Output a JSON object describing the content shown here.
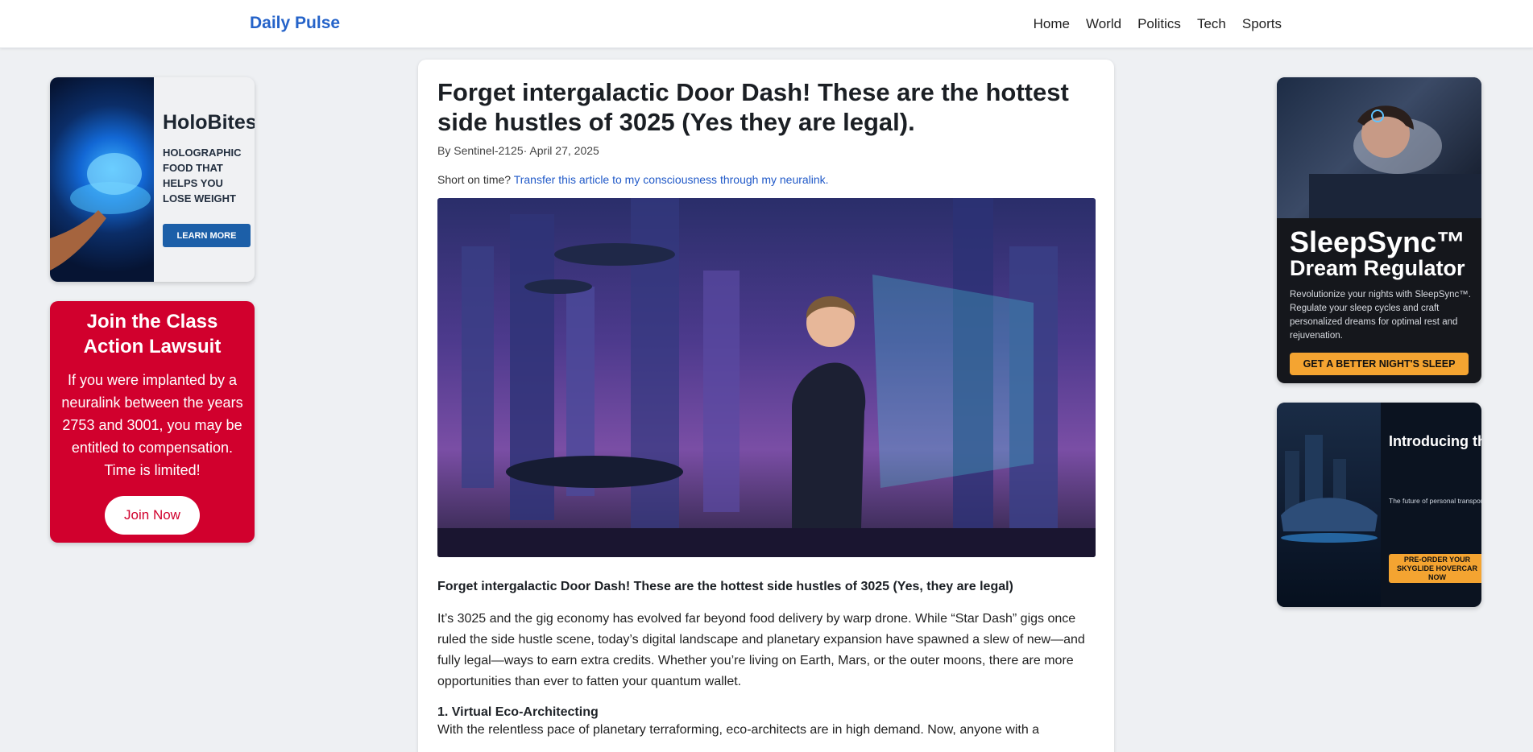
{
  "header": {
    "brand": "Daily Pulse",
    "nav": [
      "Home",
      "World",
      "Politics",
      "Tech",
      "Sports"
    ]
  },
  "ads": {
    "holobites": {
      "brand": "HoloBites™",
      "tagline": "HOLOGRAPHIC FOOD THAT HELPS YOU LOSE WEIGHT",
      "button": "LEARN MORE"
    },
    "lawsuit": {
      "title": "Join the Class Action Lawsuit",
      "body": "If you were implanted by a neuralink between the years 2753 and 3001, you may be entitled to compensation. Time is limited!",
      "button": "Join Now"
    },
    "sleepsync": {
      "title_line1": "SleepSync™",
      "title_line2": "Dream Regulator",
      "body": "Revolutionize your nights with SleepSync™. Regulate your sleep cycles and craft personalized dreams for optimal rest and rejuvenation.",
      "button": "GET A BETTER NIGHT'S SLEEP"
    },
    "skyglide": {
      "title": "Introducing the SkyGlide™ HoverCar",
      "body": "The future of personal transport is here with SkyGlide!. Glide effortlessly through the air in style and experience a new level of freedom.",
      "button": "PRE-ORDER YOUR SKYGLIDE HOVERCAR NOW"
    }
  },
  "article": {
    "title": "Forget intergalactic Door Dash! These are the hottest side hustles of 3025 (Yes they are legal).",
    "byline": "By Sentinel-2125· April 27, 2025",
    "short_prefix": "Short on time?",
    "short_link": "Transfer this article to my consciousness through my neuralink.",
    "lede": "Forget intergalactic Door Dash! These are the hottest side hustles of 3025 (Yes, they are legal)",
    "intro": "It’s 3025 and the gig economy has evolved far beyond food delivery by warp drone. While “Star Dash” gigs once ruled the side hustle scene, today’s digital landscape and planetary expansion have spawned a slew of new—and fully legal—ways to earn extra credits. Whether you’re living on Earth, Mars, or the outer moons, there are more opportunities than ever to fatten your quantum wallet.",
    "section1_heading": "1. Virtual Eco-Architecting",
    "section1_text": "With the relentless pace of planetary terraforming, eco-architects are in high demand. Now, anyone with a"
  }
}
